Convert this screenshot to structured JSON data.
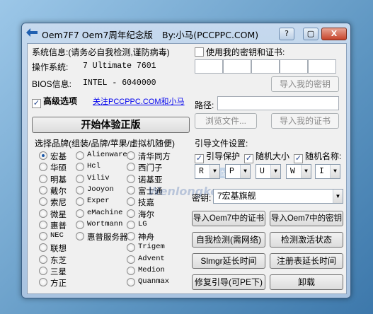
{
  "window": {
    "title": "Oem7F7 Oem7周年纪念版",
    "author": "By:小马(PCCPPC.COM)",
    "help_btn": "?",
    "min_btn": "▢",
    "close_btn": "X"
  },
  "sysinfo": {
    "header": "系统信息:(请务必自我检测,谨防病毒)",
    "os_label": "操作系统:",
    "os_value": "7 Ultimate 7601",
    "bios_label": "BIOS信息:",
    "bios_value": "INTEL  - 6040000",
    "advanced_label": "高级选项",
    "follow_link": "关注PCCPPC.COM和小马",
    "start_button": "开始体验正版"
  },
  "key": {
    "use_own_label": "使用我的密钥和证书:",
    "import_key_btn": "导入我的密钥",
    "path_label": "路径:",
    "browse_btn": "浏览文件...",
    "import_cert_btn": "导入我的证书"
  },
  "brands": {
    "header": "选择品牌(组装/品牌/苹果/虚拟机随便)",
    "col1": [
      "宏基",
      "华硕",
      "明基",
      "戴尔",
      "索尼",
      "微星",
      "惠普",
      "NEC",
      "联想",
      "东芝",
      "三星",
      "方正"
    ],
    "col2": [
      "Alienware",
      "Hcl",
      "Viliv",
      "Jooyon",
      "Exper",
      "eMachine",
      "Wortmann",
      "惠普服务器"
    ],
    "col3": [
      "清华同方",
      "西门子",
      "诺基亚",
      "富士通",
      "技嘉",
      "海尔",
      "LG",
      "神舟",
      "Trigem",
      "Advent",
      "Medion",
      "Quanmax"
    ]
  },
  "boot": {
    "header": "引导文件设置:",
    "guard_label": "引导保护",
    "random_size_label": "随机大小",
    "random_name_label": "随机名称:",
    "drives": [
      "R",
      "P",
      "U",
      "W",
      "I"
    ]
  },
  "keysel": {
    "label": "密钥:",
    "value": "7宏基旗舰"
  },
  "actions": {
    "import_oem7_cert": "导入Oem7中的证书",
    "import_oem7_key": "导入Oem7中的密钥",
    "self_check": "自我检测(需网络)",
    "check_activation": "检测激活状态",
    "slmgr_extend": "Slmgr延长时间",
    "registry_extend": "注册表延长时间",
    "repair_boot": "修复引导(可PE下)",
    "uninstall": "卸载"
  },
  "watermark": {
    "text": "网站",
    "url": "Wenlongke.com"
  }
}
